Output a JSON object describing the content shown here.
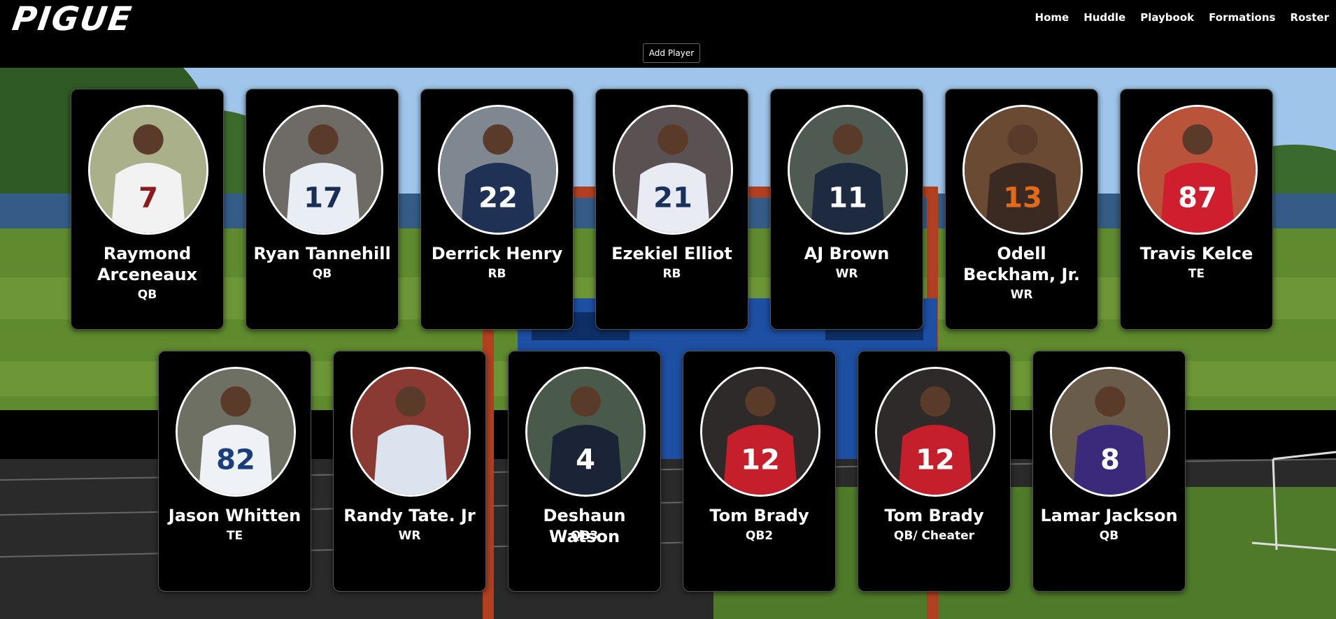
{
  "brand": {
    "logo_text": "PIGUE"
  },
  "nav": [
    {
      "label": "Home"
    },
    {
      "label": "Huddle"
    },
    {
      "label": "Playbook"
    },
    {
      "label": "Formations"
    },
    {
      "label": "Roster"
    }
  ],
  "actions": {
    "add_player_label": "Add Player"
  },
  "roster": [
    {
      "name": "Raymond Arceneaux",
      "position": "QB",
      "jersey": "7",
      "jersey_color": "#f2f2f2",
      "number_color": "#8b1a1a",
      "photo_bg": "#a9b08a"
    },
    {
      "name": "Ryan Tannehill",
      "position": "QB",
      "jersey": "17",
      "jersey_color": "#e9eef5",
      "number_color": "#1a2e55",
      "photo_bg": "#6e6a66"
    },
    {
      "name": "Derrick Henry",
      "position": "RB",
      "jersey": "22",
      "jersey_color": "#1f3154",
      "number_color": "#ffffff",
      "photo_bg": "#7f8790"
    },
    {
      "name": "Ezekiel Elliot",
      "position": "RB",
      "jersey": "21",
      "jersey_color": "#e8ecf2",
      "number_color": "#17305e",
      "photo_bg": "#5a5152"
    },
    {
      "name": "AJ Brown",
      "position": "WR",
      "jersey": "11",
      "jersey_color": "#1d2a3f",
      "number_color": "#ffffff",
      "photo_bg": "#4f5a52"
    },
    {
      "name": "Odell Beckham, Jr.",
      "position": "WR",
      "jersey": "13",
      "jersey_color": "#3a2a22",
      "number_color": "#e26b1b",
      "photo_bg": "#6a4a32"
    },
    {
      "name": "Travis Kelce",
      "position": "TE",
      "jersey": "87",
      "jersey_color": "#cf1f2e",
      "number_color": "#ffffff",
      "photo_bg": "#b9533a"
    },
    {
      "name": "Jason Whitten",
      "position": "TE",
      "jersey": "82",
      "jersey_color": "#eef1f6",
      "number_color": "#1a3d7c",
      "photo_bg": "#6f7064"
    },
    {
      "name": "Randy Tate. Jr",
      "position": "WR",
      "jersey": "",
      "jersey_color": "#dbe3ef",
      "number_color": "#ffffff",
      "photo_bg": "#8a3a32"
    },
    {
      "name": "Deshaun Watson",
      "position": "QB3",
      "jersey": "4",
      "jersey_color": "#1b2436",
      "number_color": "#ffffff",
      "photo_bg": "#4a5a4a"
    },
    {
      "name": "Tom Brady",
      "position": "QB2",
      "jersey": "12",
      "jersey_color": "#c41f2a",
      "number_color": "#ffffff",
      "photo_bg": "#2e2a2a"
    },
    {
      "name": "Tom Brady",
      "position": "QB/ Cheater",
      "jersey": "12",
      "jersey_color": "#c41f2a",
      "number_color": "#ffffff",
      "photo_bg": "#2e2a2a"
    },
    {
      "name": "Lamar Jackson",
      "position": "QB",
      "jersey": "8",
      "jersey_color": "#3b2a7a",
      "number_color": "#ffffff",
      "photo_bg": "#6a5c4a"
    }
  ],
  "colors": {
    "sky": "#9fc6ea",
    "grass": "#5f8a2e",
    "track": "#2a2a2a",
    "post": "#b0401f",
    "scoreboard": "#1d4fa3"
  },
  "icons": {
    "card_photo": "player-photo-icon"
  }
}
